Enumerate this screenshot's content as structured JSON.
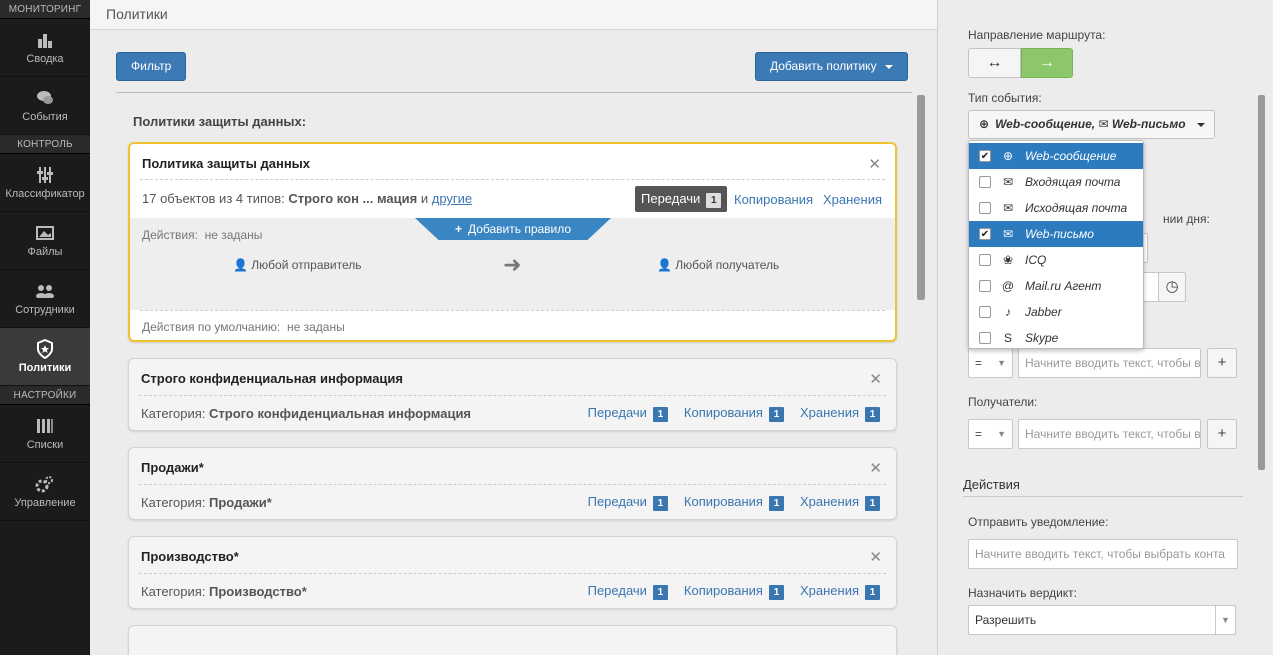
{
  "sidebar": {
    "sections": [
      "МОНИТОРИНГ",
      "КОНТРОЛЬ",
      "НАСТРОЙКИ"
    ],
    "items": [
      {
        "label": "Сводка",
        "icon": "bar-chart-icon"
      },
      {
        "label": "События",
        "icon": "chat-icon"
      },
      {
        "label": "Классификатор",
        "icon": "sliders-icon"
      },
      {
        "label": "Файлы",
        "icon": "image-icon"
      },
      {
        "label": "Сотрудники",
        "icon": "users-icon"
      },
      {
        "label": "Политики",
        "icon": "shield-star-icon",
        "active": true
      },
      {
        "label": "Списки",
        "icon": "list-icon"
      },
      {
        "label": "Управление",
        "icon": "gears-icon"
      }
    ]
  },
  "header": {
    "title": "Политики"
  },
  "toolbar": {
    "filter_label": "Фильтр",
    "add_policy_label": "Добавить политику"
  },
  "main": {
    "section_title": "Политики защиты данных:",
    "active_policy": {
      "title": "Политика защиты данных",
      "summary_prefix": "17 объектов из 4 типов: ",
      "summary_bold": "Строго кон ... мация",
      "summary_and": " и ",
      "summary_link": "другие",
      "tab_active": "Передачи",
      "tab_active_count": "1",
      "tab_copy": "Копирования",
      "tab_store": "Хранения",
      "add_rule": "Добавить правило",
      "actions_label": "Действия:",
      "actions_value": "не заданы",
      "sender": "Любой отправитель",
      "receiver": "Любой получатель",
      "default_actions_label": "Действия по умолчанию:",
      "default_actions_value": "не заданы"
    },
    "policies": [
      {
        "title": "Строго конфиденциальная информация",
        "category_label": "Категория:",
        "category": "Строго конфиденциальная информация",
        "transfers": "Передачи",
        "transfers_count": "1",
        "copies": "Копирования",
        "copies_count": "1",
        "storage": "Хранения",
        "storage_count": "1"
      },
      {
        "title": "Продажи*",
        "category_label": "Категория:",
        "category": "Продажи*",
        "transfers": "Передачи",
        "transfers_count": "1",
        "copies": "Копирования",
        "copies_count": "1",
        "storage": "Хранения",
        "storage_count": "1"
      },
      {
        "title": "Производство*",
        "category_label": "Категория:",
        "category": "Производство*",
        "transfers": "Передачи",
        "transfers_count": "1",
        "copies": "Копирования",
        "copies_count": "1",
        "storage": "Хранения",
        "storage_count": "1"
      }
    ]
  },
  "right": {
    "route_label": "Направление маршрута:",
    "route_both": "↔",
    "route_one": "→",
    "event_type_label": "Тип события:",
    "event_type_value": "Web-сообщение, ✉ Web-письмо",
    "event_type_icon": "⊕",
    "partial_day_label": "нии дня:",
    "operator": "=",
    "input_placeholder": "Начните вводить текст, чтобы в",
    "recipients_label": "Получатели:",
    "actions_header": "Действия",
    "notify_label": "Отправить уведомление:",
    "notify_placeholder": "Начните вводить текст, чтобы выбрать конта",
    "verdict_label": "Назначить вердикт:",
    "verdict_value": "Разрешить",
    "add": "+",
    "dropdown": [
      {
        "label": "Web-сообщение",
        "icon": "⊕",
        "checked": true,
        "selected": true
      },
      {
        "label": "Входящая почта",
        "icon": "✉",
        "checked": false,
        "selected": false
      },
      {
        "label": "Исходящая почта",
        "icon": "✉",
        "checked": false,
        "selected": false
      },
      {
        "label": "Web-письмо",
        "icon": "✉",
        "checked": true,
        "selected": true
      },
      {
        "label": "ICQ",
        "icon": "❀",
        "checked": false,
        "selected": false
      },
      {
        "label": "Mail.ru Агент",
        "icon": "@",
        "checked": false,
        "selected": false
      },
      {
        "label": "Jabber",
        "icon": "♪",
        "checked": false,
        "selected": false
      },
      {
        "label": "Skype",
        "icon": "S",
        "checked": false,
        "selected": false
      }
    ]
  }
}
